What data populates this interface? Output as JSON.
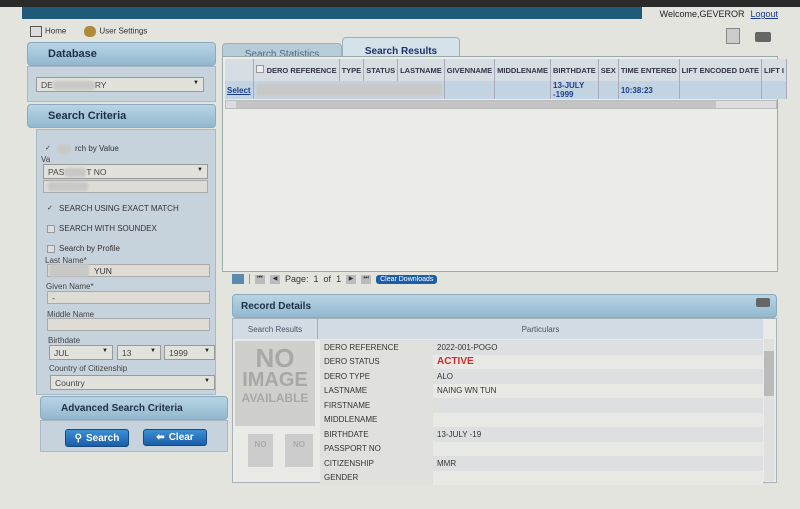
{
  "header": {
    "welcome": "Welcome,GEVEROR",
    "logout": "Logout"
  },
  "nav": [
    {
      "label": "Home",
      "icon": "home-icon"
    },
    {
      "label": "User Settings",
      "icon": "users-icon"
    }
  ],
  "sidebar": {
    "database": {
      "title": "Database",
      "value_start": "DE",
      "value_end": "RY"
    },
    "search_criteria": {
      "title": "Search Criteria",
      "search_by_value": "rch by Value",
      "via_label": "Va",
      "via_start": "PAS",
      "via_end": "T NO",
      "exact_match": "SEARCH USING EXACT MATCH",
      "soundex": "SEARCH WITH SOUNDEX",
      "by_profile": "Search by Profile",
      "last_name_label": "Last Name*",
      "last_name_value": "YUN",
      "given_name_label": "Given Name*",
      "given_name_value": "-",
      "middle_name_label": "Middle Name",
      "birthdate_label": "Birthdate",
      "month": "JUL",
      "day": "13",
      "year": "1999",
      "country_label": "Country of Citizenship",
      "country_value": "Country"
    },
    "advanced": {
      "title": "Advanced Search Criteria"
    },
    "buttons": {
      "search": "Search",
      "clear": "Clear"
    }
  },
  "tabs": [
    {
      "label": "Search Statistics",
      "active": false
    },
    {
      "label": "Search Results",
      "active": true
    }
  ],
  "results": {
    "columns": [
      "",
      "DERO REFERENCE",
      "TYPE",
      "STATUS",
      "LASTNAME",
      "GIVENNAME",
      "MIDDLENAME",
      "BIRTHDATE",
      "SEX",
      "TIME ENTERED",
      "LIFT ENCODED DATE",
      "LIFT I"
    ],
    "rows": [
      {
        "select": "Select",
        "birthdate": "13-JULY -1999",
        "time_entered": "10:38:23"
      }
    ]
  },
  "pager": {
    "page_label": "Page:",
    "page": "1",
    "of_label": "of",
    "total": "1",
    "clear_downloads": "Clear Downloads"
  },
  "record": {
    "title": "Record Details",
    "col_left": "Search Results",
    "col_right": "Particulars",
    "no_image": [
      "NO",
      "IMAGE",
      "AVAILABLE"
    ],
    "fields": [
      {
        "label": "DERO REFERENCE",
        "value": "2022-001-POGO"
      },
      {
        "label": "DERO STATUS",
        "value": "ACTIVE"
      },
      {
        "label": "DERO TYPE",
        "value": "ALO"
      },
      {
        "label": "LASTNAME",
        "value": "NAING WN TUN"
      },
      {
        "label": "FIRSTNAME",
        "value": ""
      },
      {
        "label": "MIDDLENAME",
        "value": ""
      },
      {
        "label": "BIRTHDATE",
        "value": "13-JULY -19"
      },
      {
        "label": "PASSPORT NO",
        "value": ""
      },
      {
        "label": "CITIZENSHIP",
        "value": "MMR"
      },
      {
        "label": "GENDER",
        "value": ""
      }
    ]
  },
  "colors": {
    "accent": "#1c5ea8",
    "status_active": "#d42a2a",
    "header_blue": "#1f5a78"
  }
}
